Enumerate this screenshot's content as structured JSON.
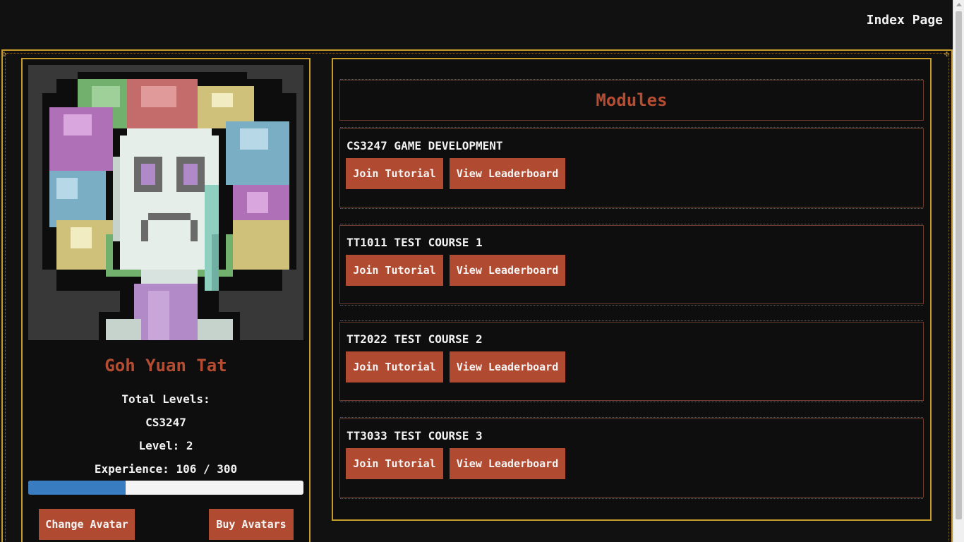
{
  "nav": {
    "index_link": "Index Page"
  },
  "profile": {
    "name": "Goh Yuan Tat",
    "total_levels_label": "Total Levels:",
    "course_code": "CS3247",
    "level_text": "Level: 2",
    "experience_text": "Experience: 106 / 300",
    "experience_current": 106,
    "experience_max": 300,
    "change_avatar_label": "Change Avatar",
    "buy_avatars_label": "Buy Avatars"
  },
  "modules": {
    "title": "Modules",
    "courses": [
      {
        "name": "CS3247 GAME DEVELOPMENT",
        "join_label": "Join Tutorial",
        "leaderboard_label": "View Leaderboard"
      },
      {
        "name": "TT1011 TEST COURSE 1",
        "join_label": "Join Tutorial",
        "leaderboard_label": "View Leaderboard"
      },
      {
        "name": "TT2022 TEST COURSE 2",
        "join_label": "Join Tutorial",
        "leaderboard_label": "View Leaderboard"
      },
      {
        "name": "TT3033 TEST COURSE 3",
        "join_label": "Join Tutorial",
        "leaderboard_label": "View Leaderboard"
      }
    ]
  },
  "colors": {
    "accent_red": "#b54d33",
    "button_bg": "#b04a30",
    "frame_gold": "#c79a2c",
    "xp_fill": "#3a7cc0",
    "background": "#121111"
  }
}
